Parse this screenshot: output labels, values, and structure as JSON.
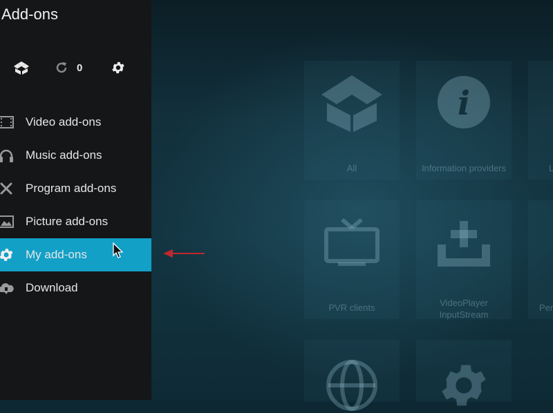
{
  "window": {
    "title": "Add-ons"
  },
  "toolbar": {
    "icons": [
      "dropbox-icon",
      "refresh-icon",
      "gear-icon"
    ],
    "update_count": "0"
  },
  "menu": {
    "items": [
      {
        "label": "Video add-ons",
        "icon": "film-icon"
      },
      {
        "label": "Music add-ons",
        "icon": "headphones-icon"
      },
      {
        "label": "Program add-ons",
        "icon": "tools-icon"
      },
      {
        "label": "Picture add-ons",
        "icon": "picture-icon"
      },
      {
        "label": "My add-ons",
        "icon": "settings-box-icon",
        "active": true
      },
      {
        "label": "Download",
        "icon": "cloud-download-icon"
      }
    ]
  },
  "tiles": [
    {
      "label": "All",
      "icon": "box-icon"
    },
    {
      "label": "Information providers",
      "icon": "info-icon"
    },
    {
      "label": "L",
      "icon": "partial-icon"
    },
    {
      "label": "PVR clients",
      "icon": "tv-icon"
    },
    {
      "label": "VideoPlayer InputStream",
      "icon": "download-tray-icon"
    },
    {
      "label": "Per",
      "icon": "partial-icon"
    },
    {
      "label": "",
      "icon": "globe-icon"
    },
    {
      "label": "",
      "icon": "gear-icon"
    }
  ],
  "colors": {
    "accent": "#12a0c7",
    "annotation_arrow": "#c0282d",
    "sidebar": "#151617"
  }
}
